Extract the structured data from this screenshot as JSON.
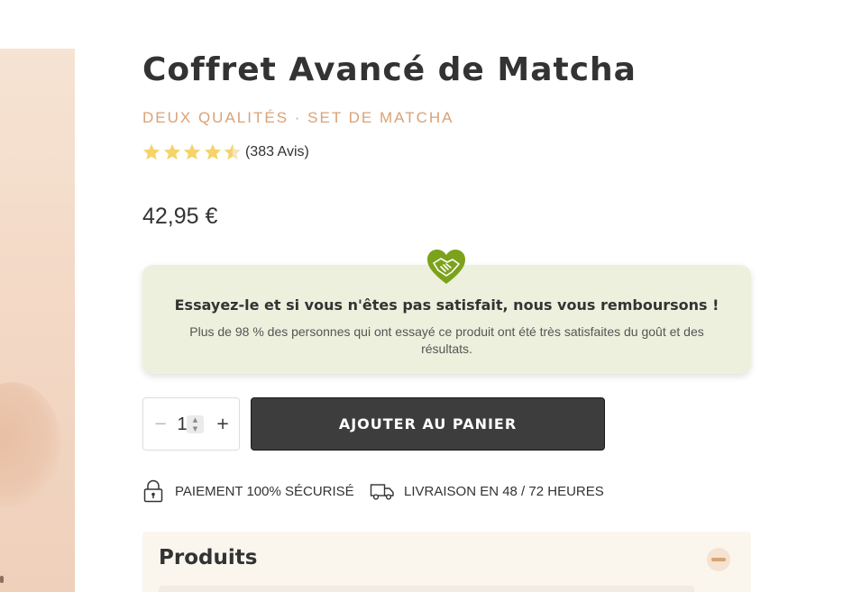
{
  "product": {
    "title": "Coffret Avancé de Matcha",
    "subtitle": "DEUX QUALITÉS · SET DE MATCHA",
    "rating": {
      "stars": 4.5,
      "max": 5,
      "count_label": "(383 Avis)"
    },
    "price": "42,95 €"
  },
  "guarantee": {
    "icon": "handshake-heart-icon",
    "title": "Essayez-le et si vous n'êtes pas satisfait, nous vous remboursons !",
    "text": "Plus de 98 % des personnes qui ont essayé ce produit ont été très satisfaites du goût et des résultats."
  },
  "purchase": {
    "quantity": "1",
    "minus_label": "−",
    "plus_label": "+",
    "add_to_cart_label": "AJOUTER AU PANIER"
  },
  "assurances": [
    {
      "icon": "padlock-icon",
      "label": "PAIEMENT 100% SÉCURISÉ"
    },
    {
      "icon": "delivery-truck-icon",
      "label": "LIVRAISON EN 48 / 72 HEURES"
    }
  ],
  "accordion": {
    "title": "Produits",
    "expanded": true
  },
  "colors": {
    "accent": "#d9a276",
    "star": "#f5d36a",
    "guarantee_bg": "#ecf0dd",
    "heart_green": "#7ca21c",
    "button_bg": "#3d3d3d"
  }
}
